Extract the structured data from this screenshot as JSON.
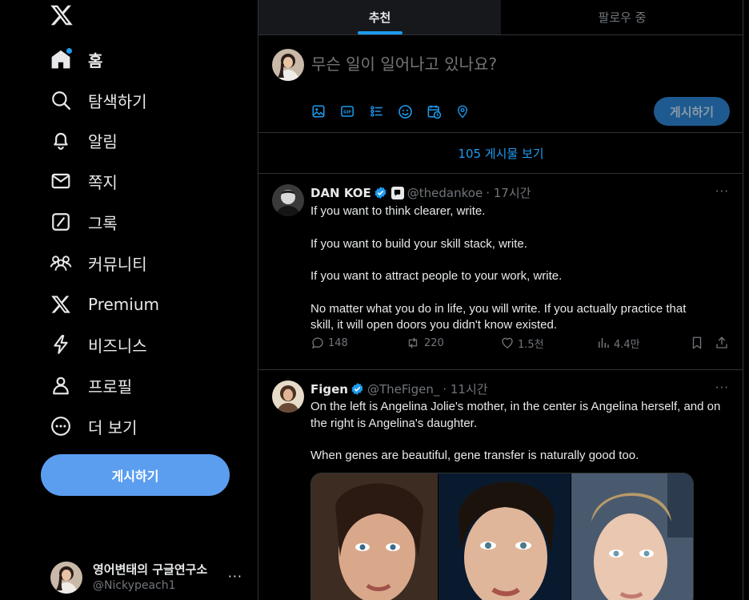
{
  "nav": {
    "items": [
      {
        "key": "home",
        "label": "홈"
      },
      {
        "key": "explore",
        "label": "탐색하기"
      },
      {
        "key": "notifications",
        "label": "알림"
      },
      {
        "key": "messages",
        "label": "쪽지"
      },
      {
        "key": "grok",
        "label": "그록"
      },
      {
        "key": "communities",
        "label": "커뮤니티"
      },
      {
        "key": "premium",
        "label": "Premium"
      },
      {
        "key": "business",
        "label": "비즈니스"
      },
      {
        "key": "profile",
        "label": "프로필"
      },
      {
        "key": "more",
        "label": "더 보기"
      }
    ],
    "post_button": "게시하기"
  },
  "account": {
    "name": "영어변태의 구글연구소",
    "handle": "@Nickypeach1",
    "more": "···"
  },
  "tabs": {
    "for_you": "추천",
    "following": "팔로우 중"
  },
  "composer": {
    "placeholder": "무슨 일이 일어나고 있나요?",
    "post_label": "게시하기",
    "tools": [
      "image-icon",
      "gif-icon",
      "poll-icon",
      "emoji-icon",
      "schedule-icon",
      "location-icon"
    ]
  },
  "feed": {
    "show_more": "105 게시물 보기"
  },
  "tweets": [
    {
      "name": "DAN KOE",
      "handle": "@thedankoe",
      "time": "· 17시간",
      "more": "···",
      "paragraphs": [
        "If you want to think clearer, write.",
        "If you want to build your skill stack, write.",
        "If you want to attract people to your work, write.",
        "No matter what you do in life, you will write. If you actually practice that skill, it will open doors you didn't know existed."
      ],
      "replies": "148",
      "reposts": "220",
      "likes": "1.5천",
      "views": "4.4만"
    },
    {
      "name": "Figen",
      "handle": "@TheFigen_",
      "time": "· 11시간",
      "more": "···",
      "paragraphs": [
        "On the left is Angelina Jolie's mother, in the center is Angelina herself, and on the right is Angelina's daughter.",
        "When genes are beautiful, gene transfer is naturally good too."
      ]
    }
  ],
  "colors": {
    "accent": "#1d9bf0",
    "post_button": "#5b9ef0",
    "divider": "#2f3336",
    "muted": "#71767b"
  }
}
